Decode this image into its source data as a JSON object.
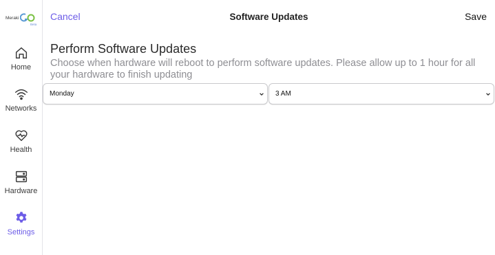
{
  "brand": {
    "wordmark": "Meraki",
    "logo_letters": "GO",
    "beta": "Beta",
    "accent_color": "#6c5ce7"
  },
  "sidebar": {
    "items": [
      {
        "label": "Home",
        "icon": "home-icon",
        "active": false
      },
      {
        "label": "Networks",
        "icon": "wifi-icon",
        "active": false
      },
      {
        "label": "Health",
        "icon": "heart-pulse-icon",
        "active": false
      },
      {
        "label": "Hardware",
        "icon": "server-icon",
        "active": false
      },
      {
        "label": "Settings",
        "icon": "gear-icon",
        "active": true
      }
    ]
  },
  "header": {
    "cancel_label": "Cancel",
    "title": "Software Updates",
    "save_label": "Save"
  },
  "main": {
    "heading": "Perform Software Updates",
    "description": "Choose when hardware will reboot to perform software updates. Please allow up to 1 hour for all your hardware to finish updating",
    "day_select": {
      "value": "Monday"
    },
    "time_select": {
      "value": "3 AM"
    }
  }
}
